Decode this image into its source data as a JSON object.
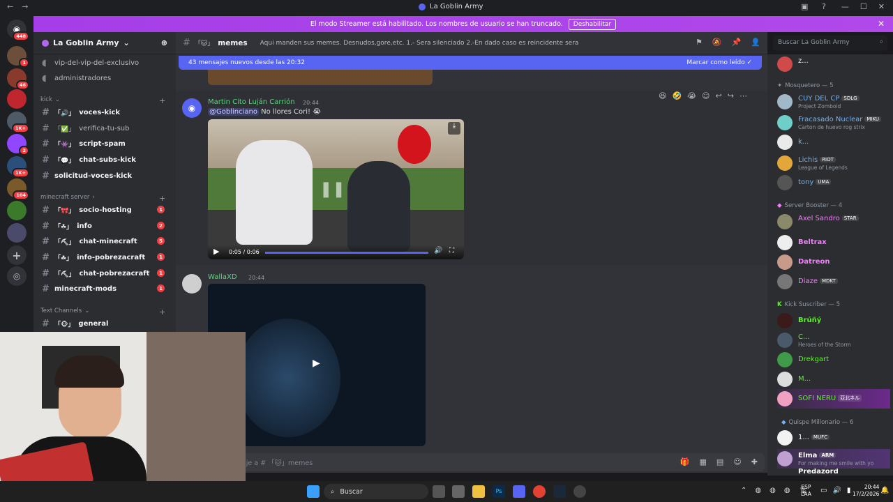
{
  "titlebar": {
    "title": "La Goblin Army"
  },
  "banner": {
    "text": "El modo Streamer está habilitado. Los nombres de usuario se han truncado.",
    "button": "Deshabilitar"
  },
  "server_badges": [
    "448",
    "1",
    "46",
    "",
    "1K+",
    "2",
    "1K+",
    "104",
    "",
    ""
  ],
  "server": {
    "name": "La Goblin Army"
  },
  "channels_top": [
    {
      "label": "vip-del-vip-del-exclusivo"
    },
    {
      "label": "administradores"
    }
  ],
  "categories": {
    "kick": "kick",
    "minecraft": "minecraft server",
    "text": "Text Channels"
  },
  "kick_channels": [
    {
      "label": "voces-kick"
    },
    {
      "label": "verifica-tu-sub"
    },
    {
      "label": "script-spam"
    },
    {
      "label": "chat-subs-kick"
    },
    {
      "label": "solicitud-voces-kick"
    }
  ],
  "mc_channels": [
    {
      "label": "socio-hosting",
      "unread": "1"
    },
    {
      "label": "info",
      "unread": "2"
    },
    {
      "label": "chat-minecraft",
      "unread": "5"
    },
    {
      "label": "info-pobrezacraft",
      "unread": "1"
    },
    {
      "label": "chat-pobrezacraft",
      "unread": "1"
    },
    {
      "label": "minecraft-mods",
      "unread": "1"
    }
  ],
  "text_channels": [
    {
      "label": "general"
    }
  ],
  "chat": {
    "channel": "memes",
    "topic": "Aqui manden sus memes. Desnudos,gore,etc. 1.- Sera silenciado 2.-En dado caso es reincidente sera baneado",
    "search_placeholder": "Buscar La Goblin Army",
    "new_messages": "43 mensajes nuevos desde las 20:32",
    "mark_read": "Marcar como leído",
    "composer_placeholder": "saje a # 「🐱」memes"
  },
  "messages": [
    {
      "author": "Martin Cito Luján Carrión",
      "time": "20:44",
      "mention": "@Goblinciano",
      "text": "No llores Cori! 😭",
      "video_time": "0:05 / 0:06"
    },
    {
      "author": "WallaXD",
      "time": "20:44"
    }
  ],
  "members": {
    "top_name": "z...",
    "groups": [
      {
        "title": "Mosquetero — 5",
        "members": [
          {
            "name": "CUY DEL CP",
            "tag": "SDLG",
            "sub": "Project Zomboid",
            "color": "#6fb3f5"
          },
          {
            "name": "Fracasado Nuclear",
            "tag": "MIKU",
            "sub": "Carton de huevo rog strix",
            "color": "#6fb3f5"
          },
          {
            "name": "k...",
            "tag": "",
            "sub": "",
            "color": "#6fb3f5"
          },
          {
            "name": "Lichis",
            "tag": "RIOT",
            "sub": "League of Legends",
            "color": "#6fb3f5"
          },
          {
            "name": "tony",
            "tag": "UMA",
            "sub": "",
            "color": "#6fb3f5"
          }
        ]
      },
      {
        "title": "Server Booster — 4",
        "members": [
          {
            "name": "Axel Sandro",
            "tag": "STAR",
            "sub": "",
            "color": "#f47fff"
          },
          {
            "name": "Beltrax",
            "tag": "",
            "sub": "",
            "color": "#f47fff"
          },
          {
            "name": "Datreon",
            "tag": "",
            "sub": "",
            "color": "#f47fff"
          },
          {
            "name": "Diaze",
            "tag": "MDKT",
            "sub": "",
            "color": "#f47fff"
          }
        ]
      },
      {
        "title": "Kick Suscriber — 5",
        "members": [
          {
            "name": "Brúñý",
            "tag": "",
            "sub": "",
            "color": "#53fc18"
          },
          {
            "name": "C...",
            "tag": "",
            "sub": "Heroes of the Storm",
            "color": "#53fc18"
          },
          {
            "name": "Drekgart",
            "tag": "",
            "sub": "",
            "color": "#53fc18"
          },
          {
            "name": "M...",
            "tag": "",
            "sub": "",
            "color": "#53fc18"
          },
          {
            "name": "SOFI NERU",
            "tag": "亞北ネル",
            "sub": "",
            "color": "#53fc18"
          }
        ]
      },
      {
        "title": "Quispe Millonario — 6",
        "members": [
          {
            "name": "1...",
            "tag": "MUFC",
            "sub": "",
            "color": "#ffffff"
          },
          {
            "name": "Elma",
            "tag": "ARM",
            "sub": "For making me smile with yo",
            "color": "#ffffff"
          },
          {
            "name": "Predazord",
            "tag": "",
            "sub": "",
            "color": "#ffffff"
          }
        ]
      }
    ]
  },
  "taskbar": {
    "search": "Buscar",
    "lang1": "ESP",
    "lang2": "LAA",
    "time": "20:44",
    "date": "17/2/2026"
  },
  "colors": {
    "accent": "#5865f2",
    "banner": "#a53ee8",
    "unread": "#f23f43"
  }
}
